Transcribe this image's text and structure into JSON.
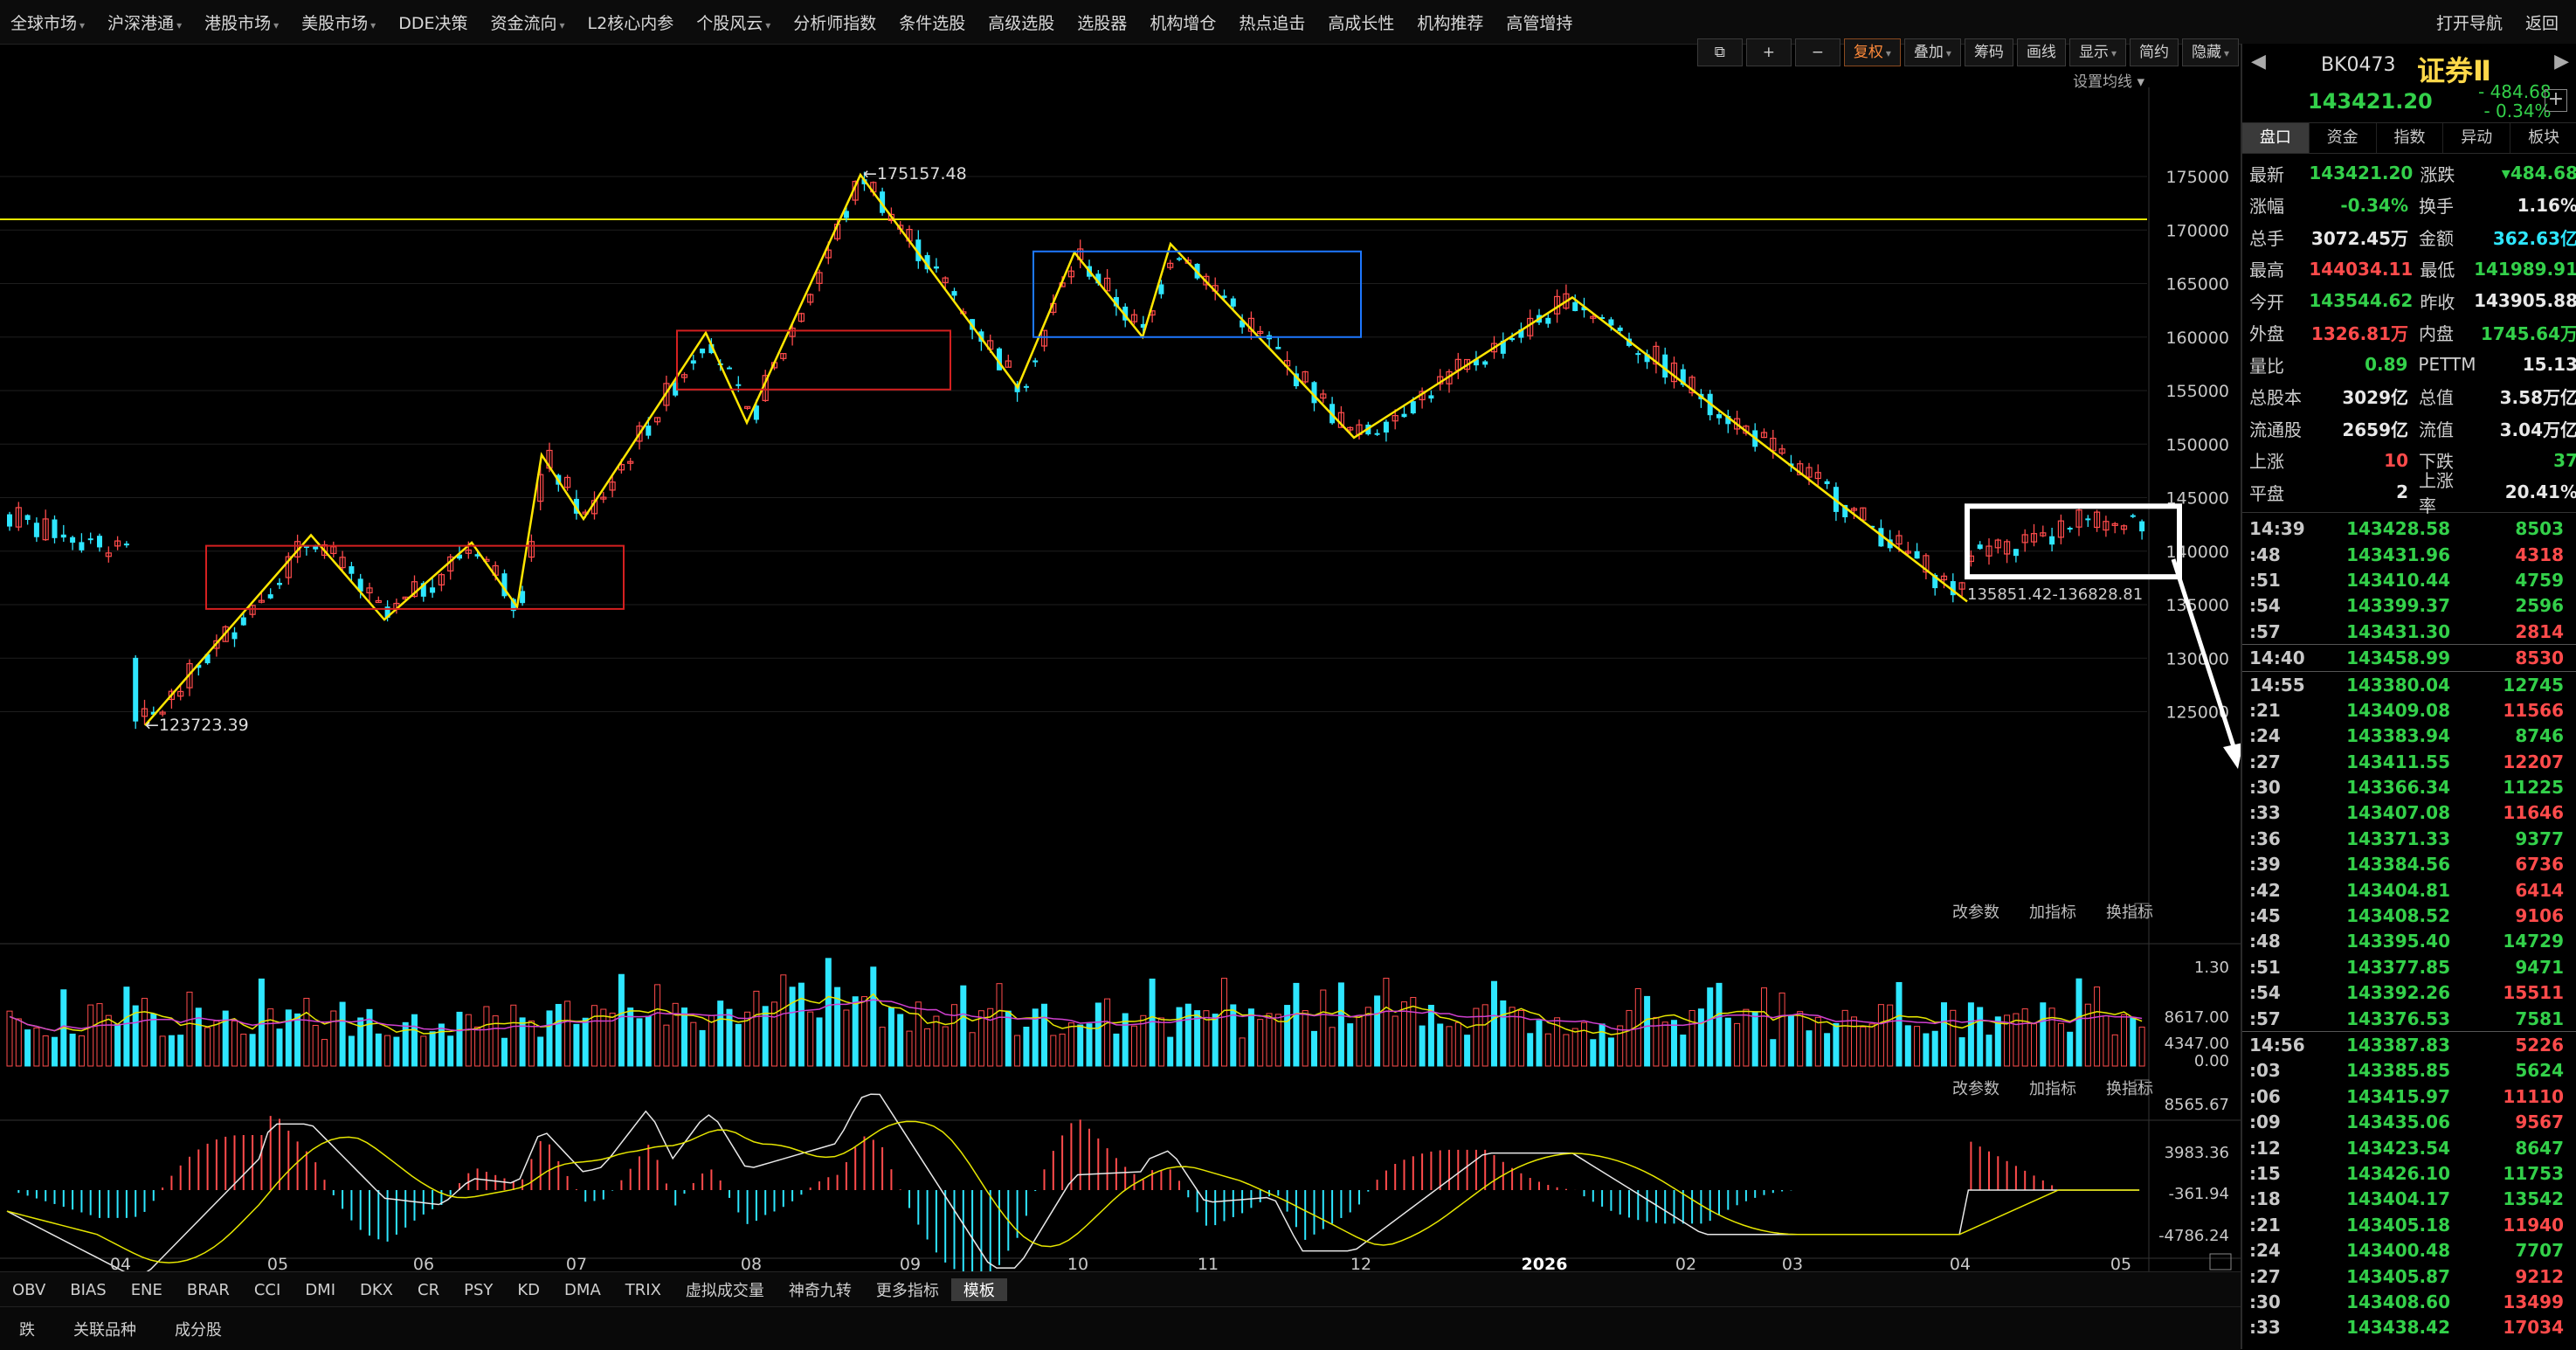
{
  "menu": {
    "items": [
      "全球市场",
      "沪深港通",
      "港股市场",
      "美股市场",
      "DDE决策",
      "资金流向",
      "L2核心内参",
      "个股风云",
      "分析师指数",
      "条件选股",
      "高级选股",
      "选股器",
      "机构增仓",
      "热点追击",
      "高成长性",
      "机构推荐",
      "高管增持"
    ],
    "dropdown": [
      true,
      true,
      true,
      true,
      false,
      true,
      false,
      true,
      false,
      false,
      false,
      false,
      false,
      false,
      false,
      false,
      false
    ],
    "right": [
      "打开导航",
      "返回"
    ]
  },
  "toolbar": {
    "fuquan": "复权",
    "diejia": "叠加",
    "chouma": "筹码",
    "huaxian": "画线",
    "xianshi": "显示",
    "jianyue": "简约",
    "yincang": "隐藏"
  },
  "chart": {
    "ma_setting": "设置均线",
    "yaxis": [
      "175000",
      "170000",
      "165000",
      "160000",
      "155000",
      "150000",
      "145000",
      "140000",
      "135000",
      "130000",
      "125000"
    ],
    "annot_high": "175157.48",
    "annot_low": "123723.39",
    "annot_range": "135851.42-136828.81",
    "months": [
      "04",
      "05",
      "06",
      "07",
      "08",
      "09",
      "10",
      "11",
      "12",
      "2026",
      "02",
      "03",
      "04",
      "05"
    ],
    "vol_axis": [
      "1.30",
      "8617.00",
      "4347.00",
      "0.00"
    ],
    "macd_axis": [
      "8565.67",
      "3983.36",
      "-361.94",
      "-4786.24"
    ],
    "panel_links": [
      "改参数",
      "加指标",
      "换指标"
    ]
  },
  "bottom_tabs": [
    "OBV",
    "BIAS",
    "ENE",
    "BRAR",
    "CCI",
    "DMI",
    "DKX",
    "CR",
    "PSY",
    "KD",
    "DMA",
    "TRIX",
    "虚拟成交量",
    "神奇九转",
    "更多指标",
    "模板"
  ],
  "status_tabs": [
    "跌",
    "关联品种",
    "成分股"
  ],
  "quote": {
    "code": "BK0473",
    "name": "证券Ⅱ",
    "price": "143421.20",
    "change": "- 484.68",
    "change_pct": "- 0.34%",
    "tabs": [
      "盘口",
      "资金",
      "指数",
      "异动",
      "板块"
    ],
    "rows": [
      [
        "最新",
        "143421.20",
        "green",
        "涨跌",
        "▾484.68",
        "green"
      ],
      [
        "涨幅",
        "-0.34%",
        "green",
        "换手",
        "1.16%",
        "white"
      ],
      [
        "总手",
        "3072.45万",
        "white",
        "金额",
        "362.63亿",
        "cyan"
      ],
      [
        "最高",
        "144034.11",
        "red",
        "最低",
        "141989.91",
        "green"
      ],
      [
        "今开",
        "143544.62",
        "green",
        "昨收",
        "143905.88",
        "white"
      ],
      [
        "外盘",
        "1326.81万",
        "red",
        "内盘",
        "1745.64万",
        "green"
      ],
      [
        "量比",
        "0.89",
        "green",
        "PETTM",
        "15.13",
        "white"
      ],
      [
        "总股本",
        "3029亿",
        "white",
        "总值",
        "3.58万亿",
        "white"
      ],
      [
        "流通股",
        "2659亿",
        "white",
        "流值",
        "3.04万亿",
        "white"
      ],
      [
        "上涨",
        "10",
        "red",
        "下跌",
        "37",
        "green"
      ],
      [
        "平盘",
        "2",
        "white",
        "上涨率",
        "20.41%",
        "white"
      ]
    ]
  },
  "ticks": [
    [
      "14:39",
      "143428.58",
      "8503",
      "green",
      false
    ],
    [
      ":48",
      "143431.96",
      "4318",
      "red",
      false
    ],
    [
      ":51",
      "143410.44",
      "4759",
      "green",
      false
    ],
    [
      ":54",
      "143399.37",
      "2596",
      "green",
      false
    ],
    [
      ":57",
      "143431.30",
      "2814",
      "red",
      false
    ],
    [
      "14:40",
      "143458.99",
      "8530",
      "red",
      true
    ],
    [
      "14:55",
      "143380.04",
      "12745",
      "green",
      true
    ],
    [
      ":21",
      "143409.08",
      "11566",
      "red",
      false
    ],
    [
      ":24",
      "143383.94",
      "8746",
      "green",
      false
    ],
    [
      ":27",
      "143411.55",
      "12207",
      "red",
      false
    ],
    [
      ":30",
      "143366.34",
      "11225",
      "green",
      false
    ],
    [
      ":33",
      "143407.08",
      "11646",
      "red",
      false
    ],
    [
      ":36",
      "143371.33",
      "9377",
      "green",
      false
    ],
    [
      ":39",
      "143384.56",
      "6736",
      "red",
      false
    ],
    [
      ":42",
      "143404.81",
      "6414",
      "red",
      false
    ],
    [
      ":45",
      "143408.52",
      "9106",
      "red",
      false
    ],
    [
      ":48",
      "143395.40",
      "14729",
      "green",
      false
    ],
    [
      ":51",
      "143377.85",
      "9471",
      "green",
      false
    ],
    [
      ":54",
      "143392.26",
      "15511",
      "red",
      false
    ],
    [
      ":57",
      "143376.53",
      "7581",
      "green",
      false
    ],
    [
      "14:56",
      "143387.83",
      "5226",
      "red",
      true
    ],
    [
      ":03",
      "143385.85",
      "5624",
      "green",
      false
    ],
    [
      ":06",
      "143415.97",
      "11110",
      "red",
      false
    ],
    [
      ":09",
      "143435.06",
      "9567",
      "red",
      false
    ],
    [
      ":12",
      "143423.54",
      "8647",
      "green",
      false
    ],
    [
      ":15",
      "143426.10",
      "11753",
      "green",
      false
    ],
    [
      ":18",
      "143404.17",
      "13542",
      "green",
      false
    ],
    [
      ":21",
      "143405.18",
      "11940",
      "red",
      false
    ],
    [
      ":24",
      "143400.48",
      "7707",
      "green",
      false
    ],
    [
      ":27",
      "143405.87",
      "9212",
      "red",
      false
    ],
    [
      ":30",
      "143408.60",
      "13499",
      "red",
      false
    ],
    [
      ":33",
      "143438.42",
      "17034",
      "red",
      false
    ]
  ],
  "colors": {
    "up": "#ff4b4b",
    "down": "#2ee6ff",
    "zigzag": "#ffe600",
    "box_red": "#d42020",
    "box_blue": "#1e78ff",
    "box_white": "#ffffff"
  }
}
